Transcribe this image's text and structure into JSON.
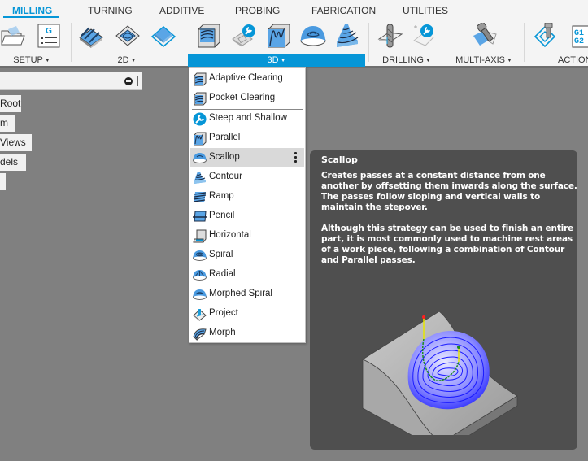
{
  "tabs": [
    {
      "label": "MILLING",
      "active": true
    },
    {
      "label": "TURNING",
      "active": false
    },
    {
      "label": "ADDITIVE",
      "active": false
    },
    {
      "label": "PROBING",
      "active": false
    },
    {
      "label": "FABRICATION",
      "active": false
    },
    {
      "label": "UTILITIES",
      "active": false
    }
  ],
  "ribbon": {
    "groups": [
      {
        "label": "SETUP",
        "has_menu": true
      },
      {
        "label": "2D",
        "has_menu": true
      },
      {
        "label": "3D",
        "has_menu": true,
        "active": true
      },
      {
        "label": "DRILLING",
        "has_menu": true
      },
      {
        "label": "MULTI-AXIS",
        "has_menu": true
      },
      {
        "label": "ACTION",
        "has_menu": false
      }
    ],
    "caret": "▼",
    "icons": {
      "setup": [
        "open-setup-icon",
        "nc-program-icon"
      ],
      "2d": [
        "2d-adaptive-icon",
        "2d-pocket-icon",
        "face-icon"
      ],
      "3d": [
        "adaptive-clearing-icon",
        "steep-shallow-icon",
        "parallel-icon",
        "scallop-icon",
        "contour-icon"
      ],
      "drilling": [
        "drill-icon",
        "hole-recognition-icon"
      ],
      "multi_axis": [
        "multi-axis-icon"
      ],
      "action": [
        "simulate-icon",
        "post-process-icon"
      ]
    },
    "post_icon_text": [
      "G1",
      "G2"
    ]
  },
  "browser": {
    "search_value": "",
    "items": [
      "Root",
      "m",
      "Views",
      "dels",
      ""
    ]
  },
  "dropdown": {
    "items": [
      {
        "label": "Adaptive Clearing",
        "icon": "adaptive-clearing-icon"
      },
      {
        "label": "Pocket Clearing",
        "icon": "pocket-clearing-icon"
      },
      {
        "label": "Steep and Shallow",
        "icon": "steep-shallow-icon"
      },
      {
        "label": "Parallel",
        "icon": "parallel-icon"
      },
      {
        "label": "Scallop",
        "icon": "scallop-icon",
        "hover": true
      },
      {
        "label": "Contour",
        "icon": "contour-icon"
      },
      {
        "label": "Ramp",
        "icon": "ramp-icon"
      },
      {
        "label": "Pencil",
        "icon": "pencil-icon"
      },
      {
        "label": "Horizontal",
        "icon": "horizontal-icon"
      },
      {
        "label": "Spiral",
        "icon": "spiral-icon"
      },
      {
        "label": "Radial",
        "icon": "radial-icon"
      },
      {
        "label": "Morphed Spiral",
        "icon": "morphed-spiral-icon"
      },
      {
        "label": "Project",
        "icon": "project-icon"
      },
      {
        "label": "Morph",
        "icon": "morph-icon"
      }
    ]
  },
  "tooltip": {
    "title": "Scallop",
    "paragraphs": [
      "Creates passes at a constant distance from one another by offsetting them inwards along the surface. The passes follow sloping and vertical walls to maintain the stepover.",
      "Although this strategy can be used to finish an entire part, it is most commonly used to machine rest areas of a work piece, following a combination of Contour and Parallel passes."
    ]
  },
  "colors": {
    "accent": "#0696d7",
    "tooltip_bg": "#4f4f4f",
    "canvas_bg": "#808080",
    "toolpath": "#1a1aff"
  }
}
